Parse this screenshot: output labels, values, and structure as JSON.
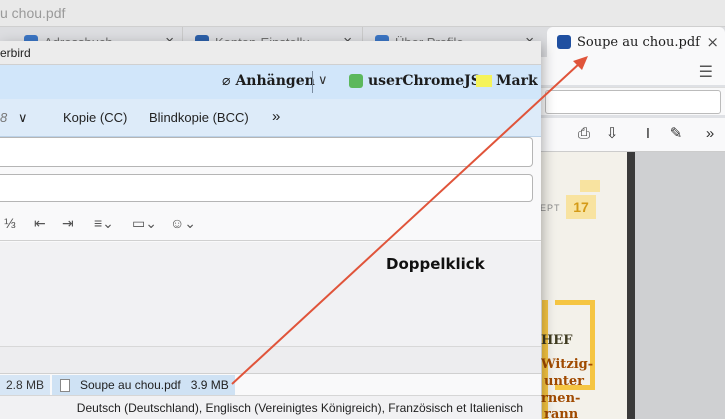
{
  "window": {
    "title": "u chou.pdf"
  },
  "tabs": [
    {
      "label": "Adressbuch",
      "icon": "address-book-icon",
      "icon_color": "#3b75c4"
    },
    {
      "label": "Konten-Einstellu...",
      "icon": "account-settings-icon",
      "icon_color": "#2c5fa8"
    },
    {
      "label": "Über Profile",
      "icon": "puzzle-profiles-icon",
      "icon_color": "#3b75c4"
    },
    {
      "label": "Soupe au chou.pdf",
      "icon": "pdf-tab-icon",
      "icon_color": "#1f4fa0",
      "active": true
    }
  ],
  "tab_close_glyph": "×",
  "compose": {
    "window_title": "erbird",
    "toolbar": {
      "attach_label": "Anhängen",
      "attach_icon": "paperclip-icon",
      "attach_glyph": "⌀",
      "dropdown_glyph": "∨",
      "userchrome_label": "userChromeJS",
      "mark_label": "Mark",
      "mark_color": "#f5f35a",
      "accent": "#d1e6fa"
    },
    "headerbar": {
      "partial_label": "8",
      "dropdown_glyph": "∨",
      "cc_label": "Kopie (CC)",
      "bcc_label": "Blindkopie (BCC)",
      "more_glyph": "»"
    },
    "format": {
      "numbered_list_glyph": "⅓",
      "outdent_glyph": "⇤",
      "indent_glyph": "⇥",
      "align_glyph": "≡⌄",
      "image_glyph": "▭⌄",
      "emoji_glyph": "☺⌄"
    },
    "annotation": "Doppelklick",
    "attachments": [
      {
        "size": "2.8 MB"
      },
      {
        "name": "Soupe au chou.pdf",
        "size": "3.9 MB",
        "icon": "pdf-file-icon"
      }
    ],
    "status": "Deutsch (Deutschland), Englisch (Vereinigtes Königreich), Französisch et Italienisch"
  },
  "pdf_viewer": {
    "menu_glyph": "☰",
    "tools": [
      {
        "name": "print-icon",
        "glyph": "⎙"
      },
      {
        "name": "save-icon",
        "glyph": "⇩"
      },
      {
        "name": "text-cursor-icon",
        "glyph": "I"
      },
      {
        "name": "draw-icon",
        "glyph": "✎"
      },
      {
        "name": "more-tools-icon",
        "glyph": "»"
      }
    ],
    "page": {
      "ept": "EPT",
      "day": "17",
      "lines": [
        "HEF",
        "Witzig-",
        "unter",
        "rnen-",
        "rann"
      ]
    }
  },
  "arrow_color": "#e0543a"
}
